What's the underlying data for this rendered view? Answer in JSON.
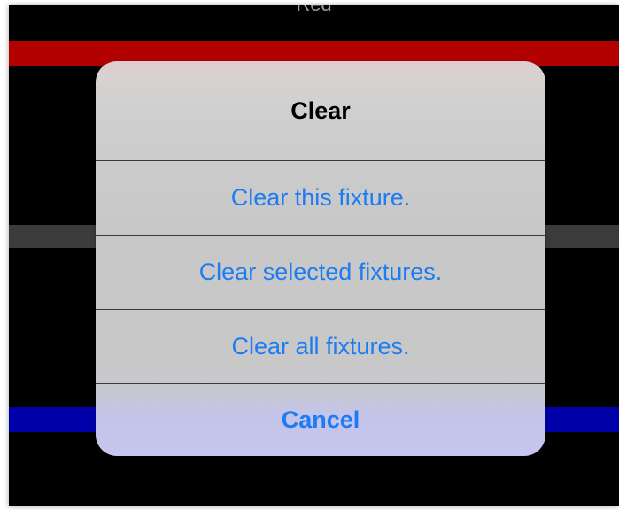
{
  "background": {
    "title_fragment": "Red",
    "colors": {
      "screen": "#000000",
      "red_bar": "#b30000",
      "gray_bar": "#3b3b3b",
      "blue_bar": "#0000a8"
    }
  },
  "action_sheet": {
    "title": "Clear",
    "actions": [
      {
        "label": "Clear this fixture."
      },
      {
        "label": "Clear selected fixtures."
      },
      {
        "label": "Clear all fixtures."
      }
    ],
    "cancel_label": "Cancel",
    "colors": {
      "action_text": "#1e7cf2",
      "title_text": "#000000",
      "separator": "#3a3a3a"
    }
  }
}
